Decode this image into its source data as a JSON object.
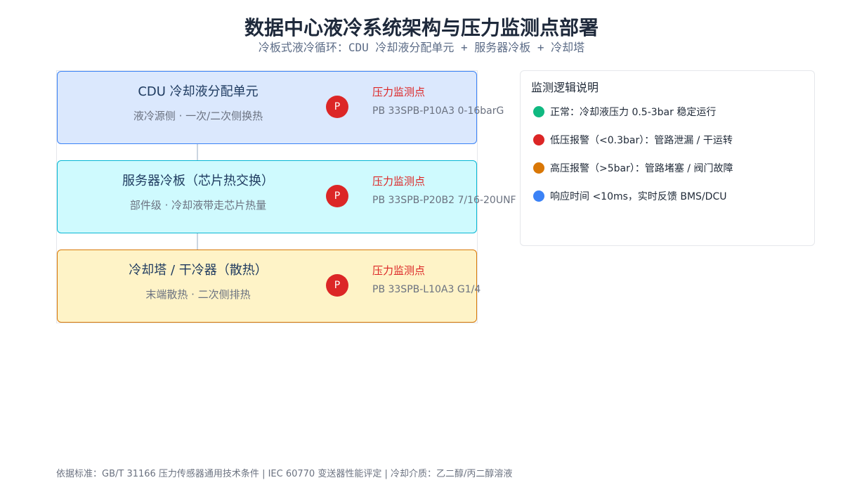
{
  "title": "数据中心液冷系统架构与压力监测点部署",
  "subtitle": "冷板式液冷循环：CDU 冷却液分配单元 + 服务器冷板 + 冷却塔",
  "stages": [
    {
      "title": "CDU 冷却液分配单元",
      "subtitle": "液冷源侧 · 一次/二次侧换热",
      "badge": "P",
      "point_label": "压力监测点",
      "model": "PB 33SPB-P10A3 0-16barG",
      "colors": {
        "fill": "#dbe8fd",
        "border": "#3b82f6"
      }
    },
    {
      "title": "服务器冷板（芯片热交换）",
      "subtitle": "部件级 · 冷却液带走芯片热量",
      "badge": "P",
      "point_label": "压力监测点",
      "model": "PB 33SPB-P20B2 7/16-20UNF",
      "colors": {
        "fill": "#cffafe",
        "border": "#06b6d4"
      }
    },
    {
      "title": "冷却塔 / 干冷器（散热）",
      "subtitle": "末端散热 · 二次侧排热",
      "badge": "P",
      "point_label": "压力监测点",
      "model": "PB 33SPB-L10A3 G1/4",
      "colors": {
        "fill": "#fef3c7",
        "border": "#d97706"
      }
    }
  ],
  "legend": {
    "title": "监测逻辑说明",
    "items": [
      {
        "text": "正常：冷却液压力 0.5-3bar 稳定运行",
        "color": "#10b981"
      },
      {
        "text": "低压报警（<0.3bar）：管路泄漏 / 干运转",
        "color": "#dc2626"
      },
      {
        "text": "高压报警（>5bar）：管路堵塞 / 阀门故障",
        "color": "#d97706"
      },
      {
        "text": "响应时间 <10ms，实时反馈 BMS/DCU",
        "color": "#3b82f6"
      }
    ]
  },
  "footer": "依据标准：GB/T 31166 压力传感器通用技术条件 | IEC 60770 变送器性能评定 | 冷却介质：乙二醇/丙二醇溶液"
}
